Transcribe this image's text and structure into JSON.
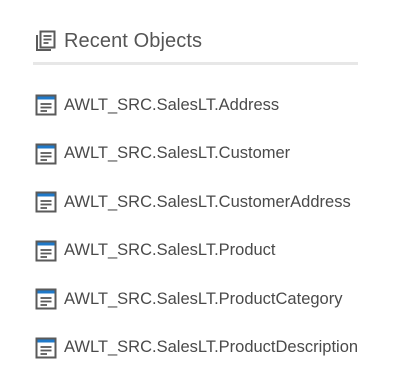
{
  "header": {
    "title": "Recent Objects",
    "icon": "recent-objects-icon"
  },
  "items": [
    {
      "label": "AWLT_SRC.SalesLT.Address",
      "icon": "table-object-icon"
    },
    {
      "label": "AWLT_SRC.SalesLT.Customer",
      "icon": "table-object-icon"
    },
    {
      "label": "AWLT_SRC.SalesLT.CustomerAddress",
      "icon": "table-object-icon"
    },
    {
      "label": "AWLT_SRC.SalesLT.Product",
      "icon": "table-object-icon"
    },
    {
      "label": "AWLT_SRC.SalesLT.ProductCategory",
      "icon": "table-object-icon"
    },
    {
      "label": "AWLT_SRC.SalesLT.ProductDescription",
      "icon": "table-object-icon"
    }
  ],
  "colors": {
    "icon_dark": "#5a5a5a",
    "icon_accent": "#1f79c9",
    "divider": "#e7e7e7"
  }
}
